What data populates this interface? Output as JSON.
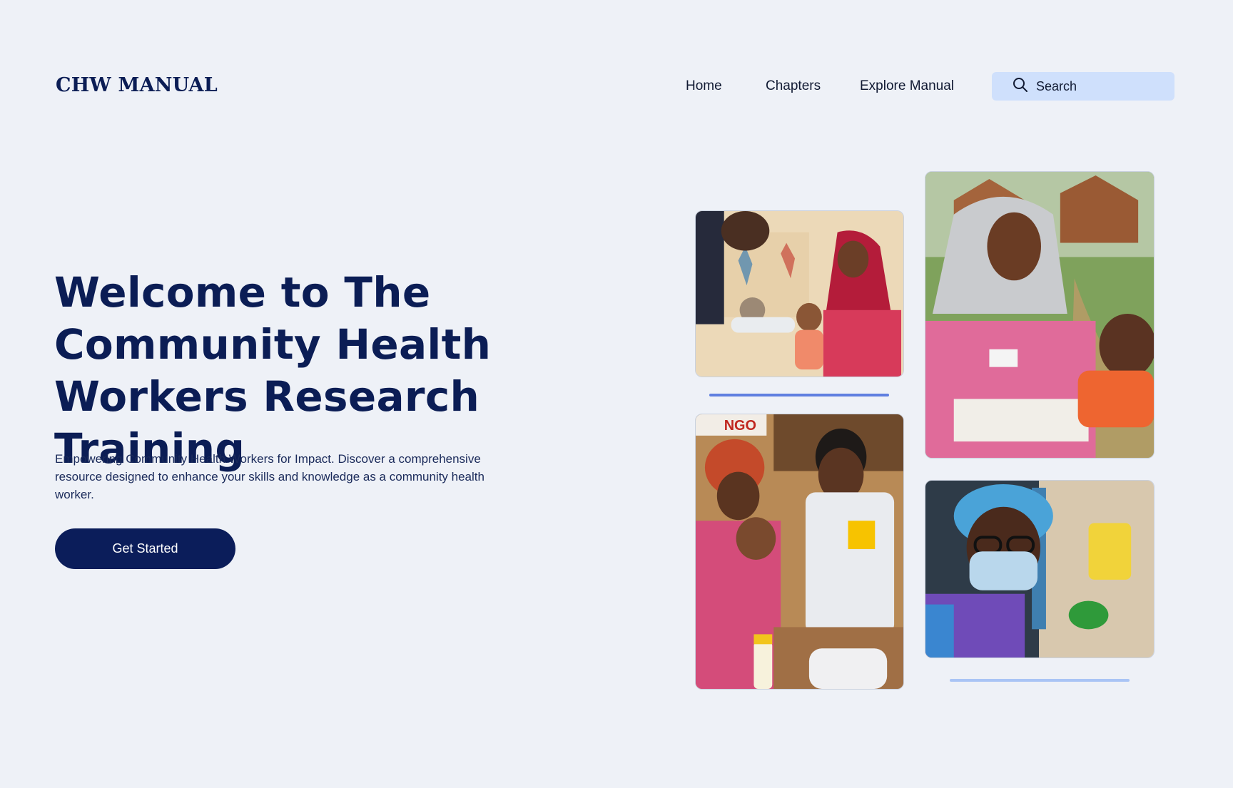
{
  "header": {
    "logo": "CHW MANUAL",
    "nav": [
      {
        "label": "Home"
      },
      {
        "label": "Chapters"
      },
      {
        "label": "Explore Manual"
      }
    ],
    "search": {
      "label": "Search",
      "icon": "search-icon"
    }
  },
  "hero": {
    "title": "Welcome to The Community Health Workers Research Training",
    "subtitle": "Empowering Community Health Workers for Impact. Discover a comprehensive resource designed to enhance your skills and knowledge as a community health worker.",
    "cta_label": "Get Started"
  },
  "gallery": {
    "photo3_sign_text": "NGO"
  },
  "colors": {
    "background": "#eef1f7",
    "primary": "#0b1d55",
    "search_bg": "#cfe0fc",
    "accent_bar": "#5f7fe0",
    "accent_bar_light": "#a9c4f5"
  }
}
